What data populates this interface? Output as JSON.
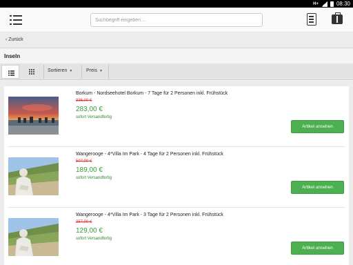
{
  "status_bar": {
    "network": "H+",
    "time": "08:30"
  },
  "header": {
    "search_placeholder": "Suchbegriff eingeben ..."
  },
  "nav": {
    "back_label": "Zurück"
  },
  "category": {
    "title": "Inseln"
  },
  "toolbar": {
    "sort_label": "Sortieren",
    "price_label": "Preis"
  },
  "products": [
    {
      "title": "Borkum - Nordseehotel Borkum - 7 Tage für 2 Personen inkl. Frühstück",
      "old_price": "936,00 €",
      "price": "283,00 €",
      "shipping": "sofort Versandfertig",
      "button": "Artikel ansehen",
      "image": "beach-sunset"
    },
    {
      "title": "Wangerooge - 4*Villa Im Park - 4 Tage für 2 Personen inkl. Frühstück",
      "old_price": "507,00 €",
      "price": "189,00 €",
      "shipping": "sofort Versandfertig",
      "button": "Artikel ansehen",
      "image": "woman-dunes"
    },
    {
      "title": "Wangerooge - 4*Villa Im Park - 3 Tage für 2 Personen inkl. Frühstück",
      "old_price": "357,00 €",
      "price": "129,00 €",
      "shipping": "sofort Versandfertig",
      "button": "Artikel ansehen",
      "image": "woman-dunes"
    }
  ],
  "colors": {
    "price_green": "#3a9a3a",
    "button_green": "#4caf50",
    "old_price_red": "#d33333"
  }
}
